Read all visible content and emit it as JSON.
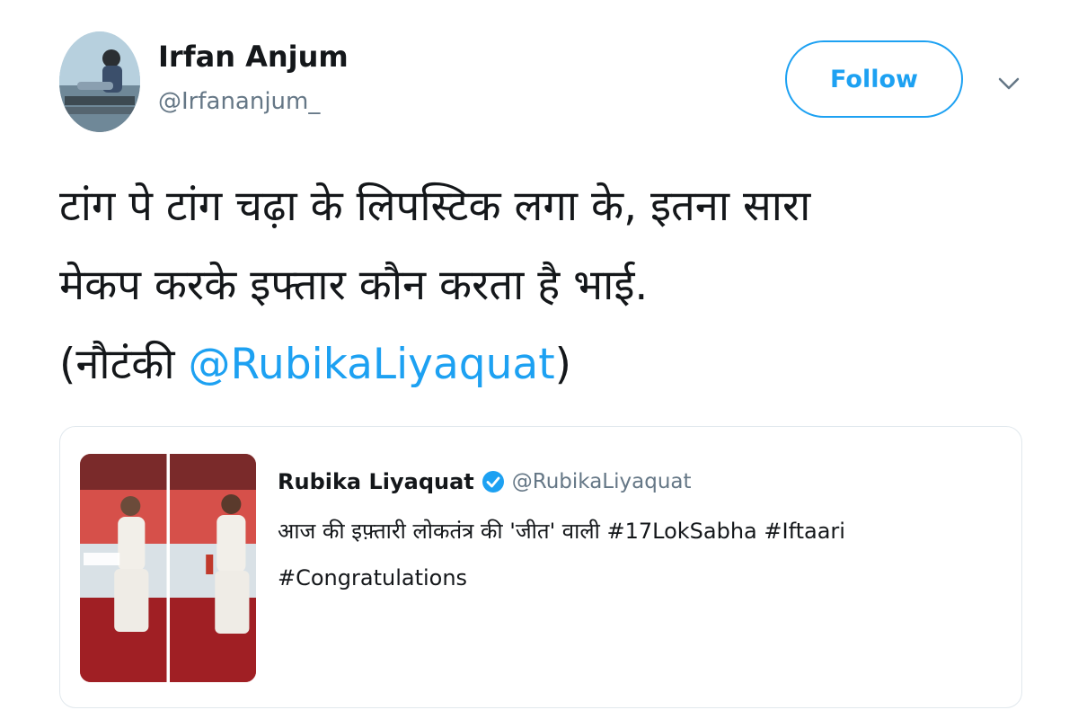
{
  "tweet": {
    "author": {
      "name": "Irfan Anjum",
      "handle": "@Irfananjum_"
    },
    "follow_label": "Follow",
    "menu_icon": "chevron-down-icon",
    "text": {
      "line1": "टांग पे टांग चढ़ा के लिपस्टिक लगा के, इतना सारा",
      "line2": "मेकप करके इफ्तार कौन करता है भाई.",
      "line3_prefix": "(नौटंकी ",
      "mention": "@RubikaLiyaquat",
      "line3_suffix": ")"
    },
    "quoted": {
      "name": "Rubika Liyaquat",
      "verified_icon": "verified-badge-icon",
      "handle": "@RubikaLiyaquat",
      "text_line1": "आज की इफ़्तारी लोकतंत्र की 'जीत' वाली #17LokSabha #Iftaari",
      "text_line2": "#Congratulations"
    }
  },
  "colors": {
    "accent": "#1da1f2",
    "text_primary": "#14171a",
    "text_secondary": "#657786",
    "border": "#e1e8ed"
  }
}
